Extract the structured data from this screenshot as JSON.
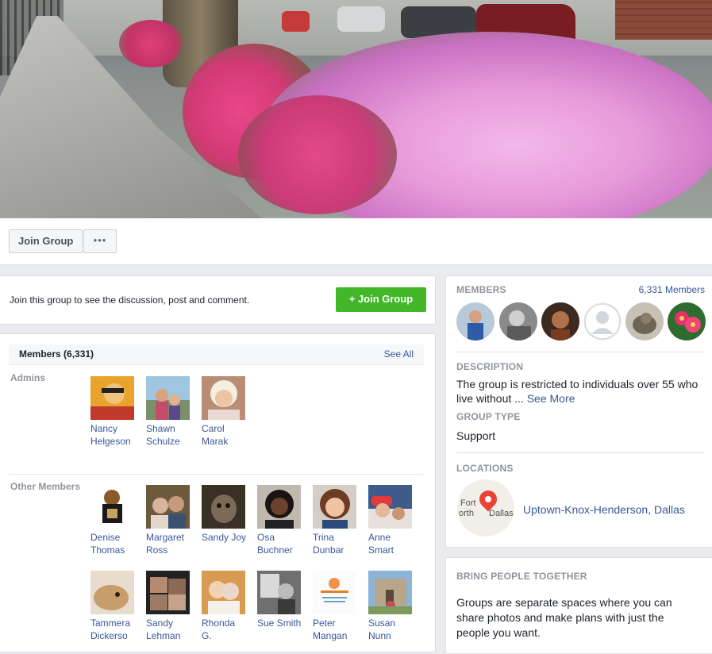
{
  "actions": {
    "join_label": "Join Group",
    "more_label": "•••"
  },
  "join_prompt": {
    "message": "Join this group to see the discussion, post and comment.",
    "button_label": "+ Join Group"
  },
  "members_panel": {
    "title": "Members (6,331)",
    "see_all": "See All",
    "admins_label": "Admins",
    "admins": [
      {
        "first": "Nancy",
        "last": "Helgeson"
      },
      {
        "first": "Shawn",
        "last": "Schulze"
      },
      {
        "first": "Carol",
        "last": "Marak"
      }
    ],
    "other_label": "Other Members",
    "others": [
      {
        "first": "Denise",
        "last": "Thomas"
      },
      {
        "first": "Margaret",
        "last": "Ross"
      },
      {
        "first": "Sandy Joy",
        "last": ""
      },
      {
        "first": "Osa",
        "last": "Buchner"
      },
      {
        "first": "Trina",
        "last": "Dunbar"
      },
      {
        "first": "Anne",
        "last": "Smart"
      },
      {
        "first": "Tammera",
        "last": "Dickerso"
      },
      {
        "first": "Sandy",
        "last": "Lehman"
      },
      {
        "first": "Rhonda",
        "last": "G."
      },
      {
        "first": "Sue Smith",
        "last": ""
      },
      {
        "first": "Peter",
        "last": "Mangan"
      },
      {
        "first": "Susan",
        "last": "Nunn"
      }
    ]
  },
  "sidebar": {
    "members_heading": "MEMBERS",
    "members_count": "6,331 Members",
    "description_heading": "DESCRIPTION",
    "description_text": "The group is restricted to individuals over 55 who live without ...",
    "see_more": "See More",
    "group_type_heading": "GROUP TYPE",
    "group_type": "Support",
    "locations_heading": "LOCATIONS",
    "map_text_1": "Fort",
    "map_text_2": "orth",
    "map_text_3": "Dallas",
    "location": "Uptown-Knox-Henderson, Dallas",
    "bring_heading": "BRING PEOPLE TOGETHER",
    "bring_text": "Groups are separate spaces where you can share photos and make plans with just the people you want."
  },
  "colors": {
    "link": "#365899",
    "green_button": "#42b72a",
    "muted": "#90949c",
    "background": "#e9ebee"
  }
}
